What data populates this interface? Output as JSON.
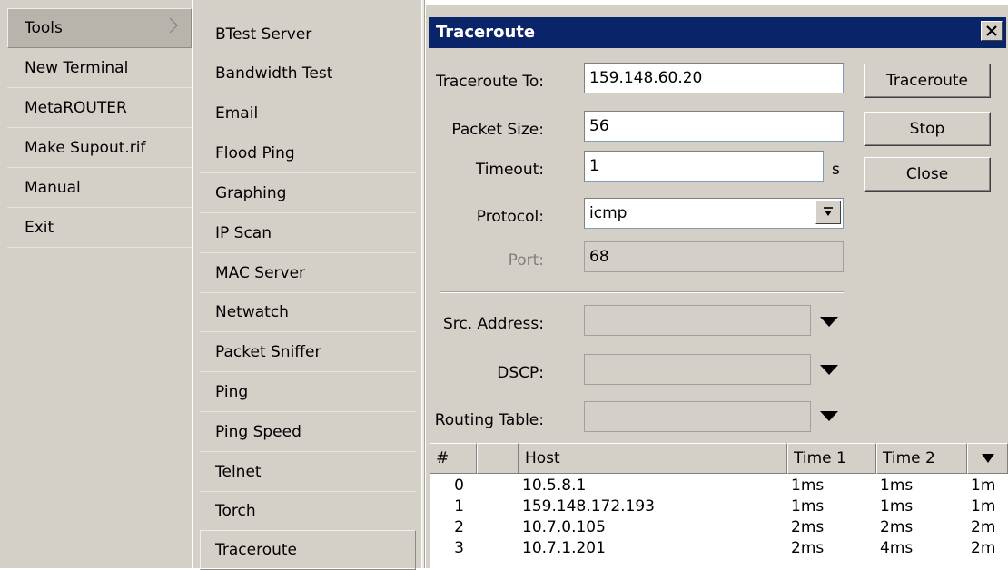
{
  "tools_menu": {
    "items": [
      {
        "label": "Tools",
        "active": true
      },
      {
        "label": "New Terminal"
      },
      {
        "label": "MetaROUTER"
      },
      {
        "label": "Make Supout.rif"
      },
      {
        "label": "Manual"
      },
      {
        "label": "Exit"
      }
    ]
  },
  "submenu": {
    "items": [
      {
        "label": "BTest Server"
      },
      {
        "label": "Bandwidth Test"
      },
      {
        "label": "Email"
      },
      {
        "label": "Flood Ping"
      },
      {
        "label": "Graphing"
      },
      {
        "label": "IP Scan"
      },
      {
        "label": "MAC Server"
      },
      {
        "label": "Netwatch"
      },
      {
        "label": "Packet Sniffer"
      },
      {
        "label": "Ping"
      },
      {
        "label": "Ping Speed"
      },
      {
        "label": "Telnet"
      },
      {
        "label": "Torch"
      },
      {
        "label": "Traceroute",
        "active": true
      }
    ]
  },
  "dialog": {
    "title": "Traceroute",
    "fields": {
      "traceroute_to": {
        "label": "Traceroute To:",
        "value": "159.148.60.20"
      },
      "packet_size": {
        "label": "Packet Size:",
        "value": "56"
      },
      "timeout": {
        "label": "Timeout:",
        "value": "1",
        "unit": "s"
      },
      "protocol": {
        "label": "Protocol:",
        "value": "icmp"
      },
      "port": {
        "label": "Port:",
        "value": "68"
      },
      "src_address": {
        "label": "Src. Address:",
        "value": ""
      },
      "dscp": {
        "label": "DSCP:",
        "value": ""
      },
      "routing_table": {
        "label": "Routing Table:",
        "value": ""
      }
    },
    "buttons": {
      "traceroute": "Traceroute",
      "stop": "Stop",
      "close": "Close"
    },
    "table": {
      "columns": [
        "#",
        "",
        "Host",
        "Time 1",
        "Time 2"
      ],
      "rows": [
        {
          "n": "0",
          "host": "10.5.8.1",
          "t1": "1ms",
          "t2": "1ms",
          "t3": "1m"
        },
        {
          "n": "1",
          "host": "159.148.172.193",
          "t1": "1ms",
          "t2": "1ms",
          "t3": "1m"
        },
        {
          "n": "2",
          "host": "10.7.0.105",
          "t1": "2ms",
          "t2": "2ms",
          "t3": "2m"
        },
        {
          "n": "3",
          "host": "10.7.1.201",
          "t1": "2ms",
          "t2": "4ms",
          "t3": "2m"
        }
      ]
    }
  }
}
